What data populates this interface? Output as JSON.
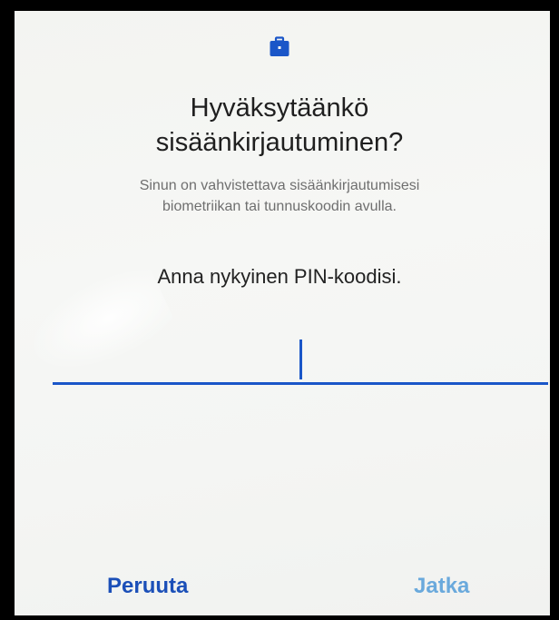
{
  "dialog": {
    "title_line1": "Hyväksytäänkö",
    "title_line2": "sisäänkirjautuminen?",
    "subtitle_line1": "Sinun on vahvistettava sisäänkirjautumisesi",
    "subtitle_line2": "biometriikan tai tunnuskoodin avulla.",
    "prompt": "Anna nykyinen PIN-koodisi.",
    "icon": "briefcase-icon"
  },
  "pin_field": {
    "value": "",
    "placeholder": ""
  },
  "actions": {
    "cancel_label": "Peruuta",
    "continue_label": "Jatka"
  },
  "colors": {
    "accent": "#1a56c8",
    "cancel": "#1b4fb8",
    "continue_disabled": "#6aa9dc"
  }
}
